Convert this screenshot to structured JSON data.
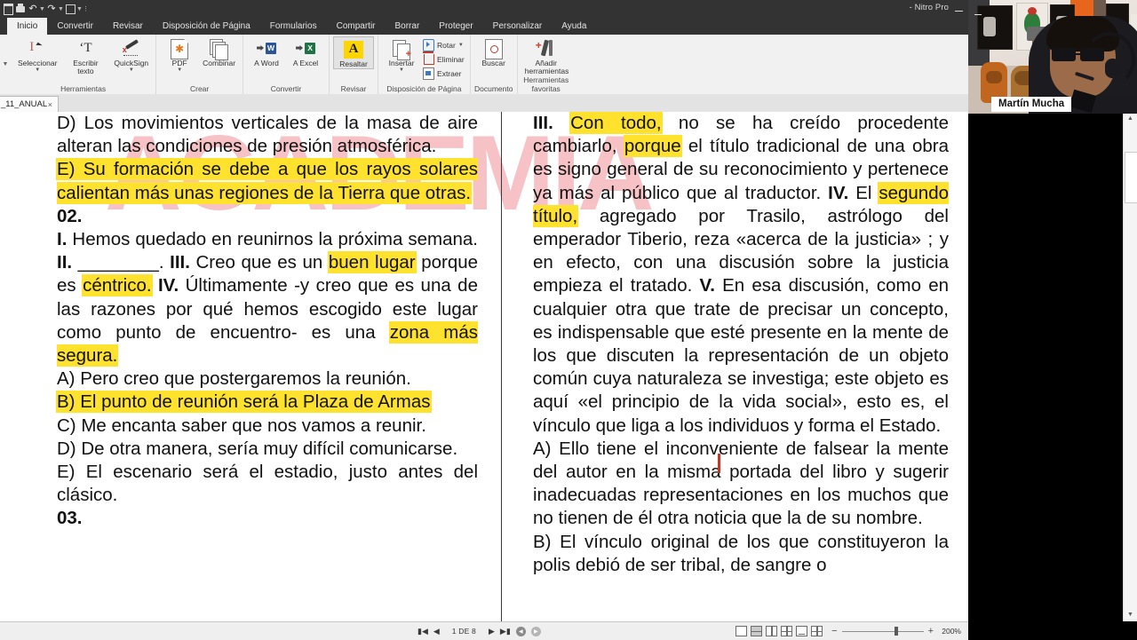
{
  "window": {
    "title": "- Nitro Pro",
    "minimize_label": "Minimizar",
    "quick_access": [
      "save-icon",
      "print-icon",
      "undo-icon",
      "redo-icon",
      "customize-icon"
    ]
  },
  "ribbon": {
    "tabs": [
      {
        "label": "Inicio",
        "active": true
      },
      {
        "label": "Convertir",
        "active": false
      },
      {
        "label": "Revisar",
        "active": false
      },
      {
        "label": "Disposición de Página",
        "active": false
      },
      {
        "label": "Formularios",
        "active": false
      },
      {
        "label": "Compartir",
        "active": false
      },
      {
        "label": "Borrar",
        "active": false
      },
      {
        "label": "Proteger",
        "active": false
      },
      {
        "label": "Personalizar",
        "active": false
      },
      {
        "label": "Ayuda",
        "active": false
      }
    ],
    "groups": [
      {
        "label": "Herramientas",
        "buttons": [
          {
            "label": "Seleccionar",
            "icon": "select-cursor-icon",
            "caret": true
          },
          {
            "label": "Escribir texto",
            "icon": "type-text-icon",
            "caret": false
          },
          {
            "label": "QuickSign",
            "icon": "quicksign-pen-icon",
            "caret": true
          }
        ]
      },
      {
        "label": "Crear",
        "buttons": [
          {
            "label": "PDF",
            "icon": "pdf-page-icon",
            "caret": true
          },
          {
            "label": "Combinar",
            "icon": "combine-pages-icon",
            "caret": false
          }
        ]
      },
      {
        "label": "Convertir",
        "buttons": [
          {
            "label": "A Word",
            "icon": "to-word-icon",
            "caret": false
          },
          {
            "label": "A Excel",
            "icon": "to-excel-icon",
            "caret": false
          }
        ]
      },
      {
        "label": "Revisar",
        "buttons": [
          {
            "label": "Resaltar",
            "icon": "highlight-icon",
            "caret": false,
            "selected": true
          }
        ]
      },
      {
        "label": "Disposición de Página",
        "buttons": [
          {
            "label": "Insertar",
            "icon": "insert-pages-icon",
            "caret": true
          }
        ],
        "small_buttons": [
          {
            "label": "Rotar",
            "icon": "rotate-icon",
            "caret": true
          },
          {
            "label": "Eliminar",
            "icon": "delete-page-icon",
            "caret": false
          },
          {
            "label": "Extraer",
            "icon": "extract-page-icon",
            "caret": false
          }
        ]
      },
      {
        "label": "Documento",
        "buttons": [
          {
            "label": "Buscar",
            "icon": "search-document-icon",
            "caret": false
          }
        ]
      },
      {
        "label": "Herramientas favoritas",
        "buttons": [
          {
            "label": "Añadir herramientas",
            "icon": "add-tools-icon",
            "caret": false
          }
        ]
      }
    ]
  },
  "doc_tab": {
    "label": "_11_ANUAL",
    "close_label": "×"
  },
  "document": {
    "watermark": "ACADEMIA",
    "left_column": {
      "options_q01": [
        {
          "prefix": "D)",
          "text": " Los movimientos verticales de la masa de aire alteran las condiciones de presión atmosférica.",
          "highlight": false
        },
        {
          "prefix": "E)",
          "text": " Su formación se debe a que los rayos solares calientan más unas regiones de la Tierra que otras.",
          "highlight": true
        }
      ],
      "q02_number": "02.",
      "q02_stem_parts": [
        {
          "t": "I.",
          "bold": true
        },
        {
          "t": " Hemos quedado en reunirnos la próxima semana. ",
          "bold": false
        },
        {
          "t": "II.",
          "bold": true
        },
        {
          "t": " ________. ",
          "bold": false
        },
        {
          "t": "III.",
          "bold": true
        },
        {
          "t": " Creo que es un ",
          "bold": false
        },
        {
          "t": "buen lugar",
          "bold": false,
          "hl": true
        },
        {
          "t": " porque es ",
          "bold": false
        },
        {
          "t": "céntrico.",
          "bold": false,
          "hl": true
        },
        {
          "t": " IV.",
          "bold": true
        },
        {
          "t": " Últimamente -y creo que es una de las razones por qué hemos escogido este lugar como punto de encuentro- es una ",
          "bold": false
        },
        {
          "t": "zona más segura.",
          "bold": false,
          "hl": true
        }
      ],
      "q02_options": [
        {
          "prefix": "A)",
          "text": " Pero creo que postergaremos la reunión.",
          "highlight": false
        },
        {
          "prefix": "B)",
          "text": " El punto de reunión será la Plaza de Armas",
          "highlight": true
        },
        {
          "prefix": "C)",
          "text": " Me encanta saber que nos vamos a reunir.",
          "highlight": false
        },
        {
          "prefix": "D)",
          "text": " De otra manera, sería muy difícil comunicarse.",
          "highlight": false
        },
        {
          "prefix": "E)",
          "text": " El escenario será el estadio, justo antes del clásico.",
          "highlight": false
        }
      ],
      "q03_number": "03."
    },
    "right_column": {
      "stem_parts": [
        {
          "t": "III.",
          "bold": true
        },
        {
          "t": " ",
          "bold": false
        },
        {
          "t": "Con todo,",
          "bold": false,
          "hl": true
        },
        {
          "t": " no se ha creído procedente cambiarlo, ",
          "bold": false
        },
        {
          "t": "porque",
          "bold": false,
          "hl": true
        },
        {
          "t": " el título tradicional de una obra es signo general de su reconocimiento y pertenece ya más al público que al traductor. ",
          "bold": false
        },
        {
          "t": "IV.",
          "bold": true
        },
        {
          "t": " El ",
          "bold": false
        },
        {
          "t": "segundo título,",
          "bold": false,
          "hl": true
        },
        {
          "t": " agregado por Trasilo, astrólogo del emperador Tiberio, reza «acerca de la justicia» ; y en efecto, con una discusión sobre la justicia empieza el tratado. ",
          "bold": false
        },
        {
          "t": "V.",
          "bold": true
        },
        {
          "t": " En esa discusión, como en cualquier otra que trate de precisar un concepto, es indispensable que esté presente en la mente de los que discuten la representación de un objeto común cuya naturaleza se investiga; este objeto es aquí «el principio de la vida social», esto es, el vínculo que liga a los individuos y forma el Estado.",
          "bold": false
        }
      ],
      "options": [
        {
          "prefix": "A)",
          "text": " Ello tiene el inconveniente de falsear la mente del autor en la misma portada del libro y sugerir inadecuadas representaciones en los muchos que no tienen de él otra noticia que la de su nombre.",
          "highlight": false
        },
        {
          "prefix": "B)",
          "text": " El vínculo original de los que constituyeron la polis debió de ser tribal, de sangre o",
          "highlight": false
        }
      ]
    }
  },
  "statusbar": {
    "first_page_label": "Primera página",
    "prev_page_label": "Página anterior",
    "page_indicator": "1 DE 8",
    "next_page_label": "Página siguiente",
    "last_page_label": "Última página",
    "back_label": "Atrás",
    "forward_label": "Adelante",
    "view_modes": [
      "single-page-icon",
      "continuous-icon",
      "facing-icon",
      "facing-continuous-icon",
      "fit-page-icon",
      "full-screen-icon"
    ],
    "zoom_out": "−",
    "zoom_in": "+",
    "zoom_value": "200%"
  },
  "webcam": {
    "name": "Martín Mucha",
    "minimize_label": "Minimizar cámara"
  },
  "colors": {
    "highlight_yellow": "#ffe22e",
    "highlight_orange": "#ffc400",
    "ribbon_bg": "#f1f1f1",
    "titlebar_bg": "#333333",
    "accent_red": "#c0392b",
    "watermark_pink": "#f6b8bd"
  }
}
